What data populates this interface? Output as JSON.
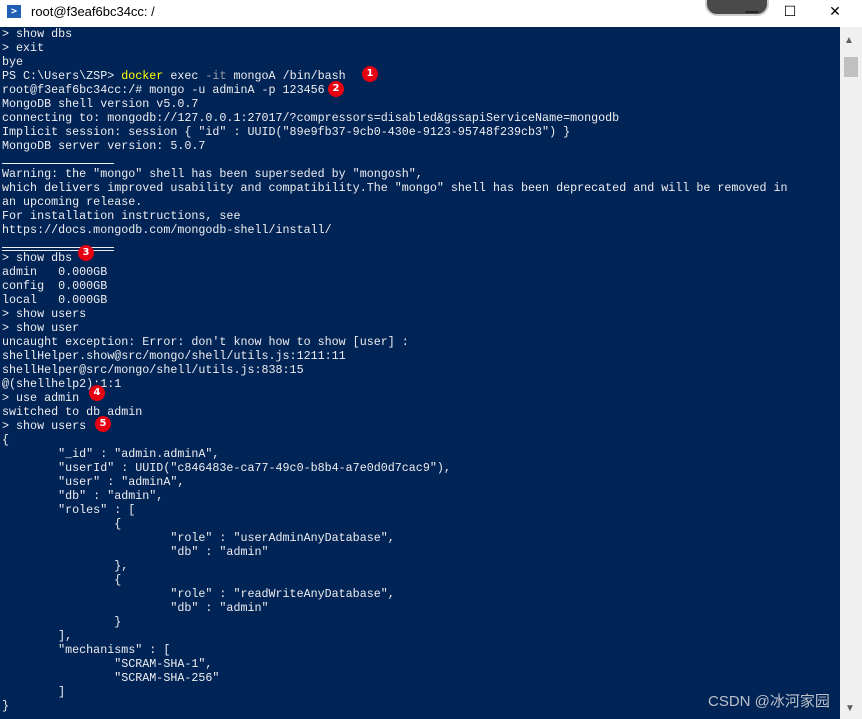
{
  "window": {
    "title": "root@f3eaf6bc34cc: /",
    "icon": "powershell-icon",
    "controls": {
      "minimize": "—",
      "maximize": "☐",
      "close": "✕"
    }
  },
  "colors": {
    "background": "#012456",
    "text": "#eeedf0",
    "command": "#ffff00",
    "param": "#9aa0a6",
    "badge": "#e60012"
  },
  "terminal": {
    "lines": [
      "> show dbs",
      "> exit",
      "bye",
      {
        "segments": [
          {
            "t": "PS C:\\Users\\ZSP> "
          },
          {
            "t": "docker",
            "c": "y"
          },
          {
            "t": " exec "
          },
          {
            "t": "-it",
            "c": "g"
          },
          {
            "t": " mongoA /bin/bash"
          }
        ],
        "badge": "1"
      },
      {
        "text": "root@f3eaf6bc34cc:/# mongo -u adminA -p 123456",
        "badge": "2"
      },
      "MongoDB shell version v5.0.7",
      "connecting to: mongodb://127.0.0.1:27017/?compressors=disabled&gssapiServiceName=mongodb",
      "Implicit session: session { \"id\" : UUID(\"89e9fb37-9cb0-430e-9123-95748f239cb3\") }",
      "MongoDB server version: 5.0.7",
      {
        "sep": "single"
      },
      "Warning: the \"mongo\" shell has been superseded by \"mongosh\",",
      "which delivers improved usability and compatibility.The \"mongo\" shell has been deprecated and will be removed in",
      "an upcoming release.",
      "For installation instructions, see",
      "https://docs.mongodb.com/mongodb-shell/install/",
      {
        "sep": "double"
      },
      {
        "text": "> show dbs",
        "badge": "3"
      },
      "admin   0.000GB",
      "config  0.000GB",
      "local   0.000GB",
      "> show users",
      "> show user",
      "uncaught exception: Error: don't know how to show [user] :",
      "shellHelper.show@src/mongo/shell/utils.js:1211:11",
      "shellHelper@src/mongo/shell/utils.js:838:15",
      "@(shellhelp2):1:1",
      {
        "text": "> use admin",
        "badge": "4"
      },
      "switched to db admin",
      {
        "text": "> show users",
        "badge": "5"
      },
      "{",
      "\t\"_id\" : \"admin.adminA\",",
      "\t\"userId\" : UUID(\"c846483e-ca77-49c0-b8b4-a7e0d0d7cac9\"),",
      "\t\"user\" : \"adminA\",",
      "\t\"db\" : \"admin\",",
      "\t\"roles\" : [",
      "\t\t{",
      "\t\t\t\"role\" : \"userAdminAnyDatabase\",",
      "\t\t\t\"db\" : \"admin\"",
      "\t\t},",
      "\t\t{",
      "\t\t\t\"role\" : \"readWriteAnyDatabase\",",
      "\t\t\t\"db\" : \"admin\"",
      "\t\t}",
      "\t],",
      "\t\"mechanisms\" : [",
      "\t\t\"SCRAM-SHA-1\",",
      "\t\t\"SCRAM-SHA-256\"",
      "\t]",
      "}"
    ]
  },
  "watermark": "CSDN @冰河家园"
}
